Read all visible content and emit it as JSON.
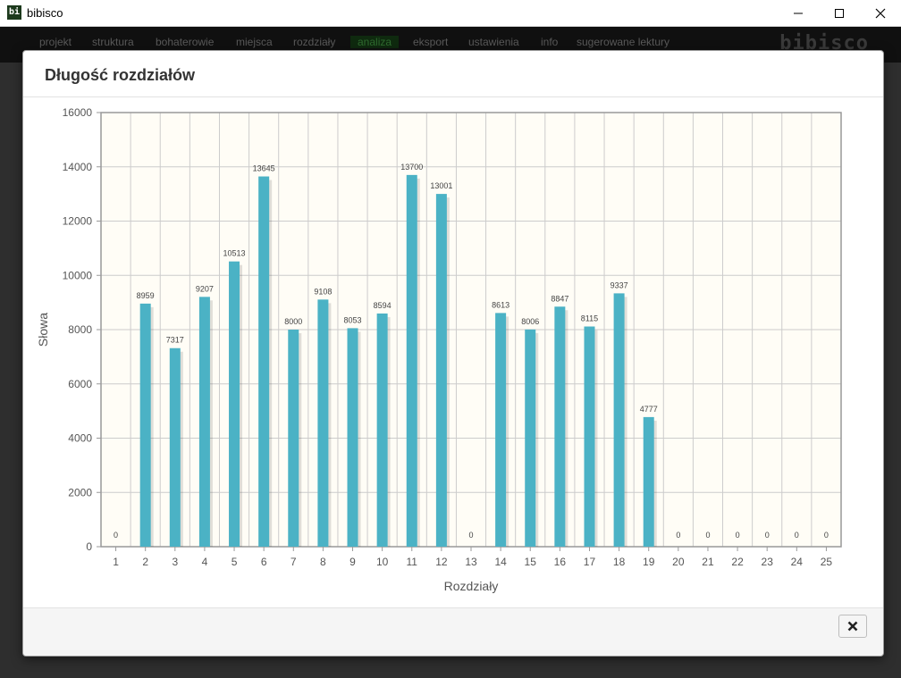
{
  "window": {
    "title": "bibisco",
    "icon_text": "bi"
  },
  "nav": {
    "items": [
      "projekt",
      "struktura",
      "bohaterowie",
      "miejsca",
      "rozdziały",
      "analiza",
      "eksport",
      "ustawienia",
      "info",
      "sugerowane lektury"
    ],
    "active": "analiza",
    "brand": "bibisco"
  },
  "modal": {
    "title": "Długość rozdziałów",
    "close_icon": "close-icon"
  },
  "chart_data": {
    "type": "bar",
    "xlabel": "Rozdziały",
    "ylabel": "Słowa",
    "ylim": [
      0,
      16000
    ],
    "yticks": [
      0,
      2000,
      4000,
      6000,
      8000,
      10000,
      12000,
      14000,
      16000
    ],
    "grid": true,
    "categories": [
      "1",
      "2",
      "3",
      "4",
      "5",
      "6",
      "7",
      "8",
      "9",
      "10",
      "11",
      "12",
      "13",
      "14",
      "15",
      "16",
      "17",
      "18",
      "19",
      "20",
      "21",
      "22",
      "23",
      "24",
      "25"
    ],
    "values": [
      0,
      8959,
      7317,
      9207,
      10513,
      13645,
      8000,
      9108,
      8053,
      8594,
      13700,
      13001,
      0,
      8613,
      8006,
      8847,
      8115,
      9337,
      4777,
      0,
      0,
      0,
      0,
      0,
      0
    ],
    "colors": {
      "bar": "#4bb2c5",
      "plot_bg": "#fffdf6",
      "grid": "#cccccc"
    }
  }
}
